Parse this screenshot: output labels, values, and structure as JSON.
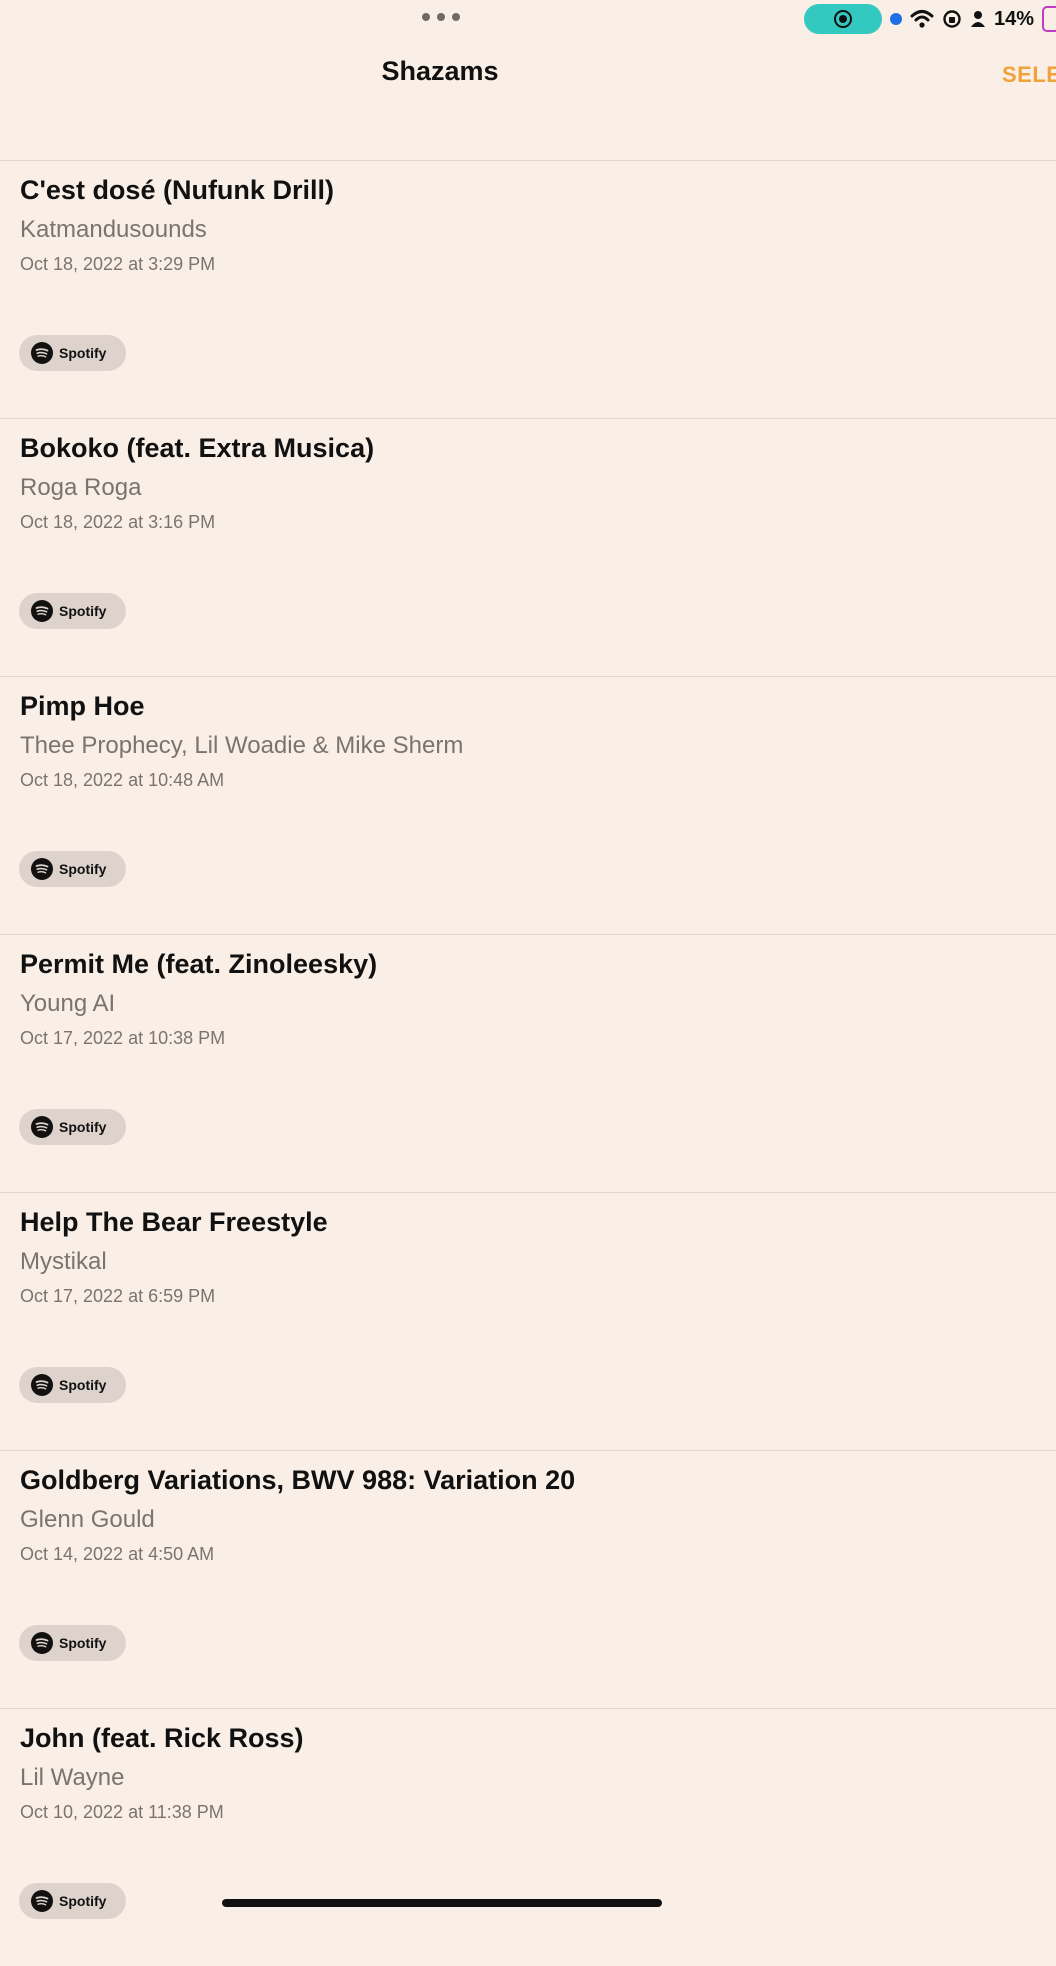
{
  "status_bar": {
    "battery_percent": "14%",
    "icons": [
      "screen-record-icon",
      "location-dot-icon",
      "wifi-icon",
      "orientation-lock-icon",
      "person-icon",
      "battery-icon"
    ]
  },
  "nav": {
    "title": "Shazams",
    "select_label": "SELE"
  },
  "items": [
    {
      "title": "C'est dosé (Nufunk Drill)",
      "artist": "Katmandusounds",
      "date": "Oct 18, 2022 at 3:29 PM",
      "service": "Spotify"
    },
    {
      "title": "Bokoko (feat. Extra Musica)",
      "artist": "Roga Roga",
      "date": "Oct 18, 2022 at 3:16 PM",
      "service": "Spotify"
    },
    {
      "title": "Pimp Hoe",
      "artist": "Thee Prophecy, Lil Woadie & Mike Sherm",
      "date": "Oct 18, 2022 at 10:48 AM",
      "service": "Spotify"
    },
    {
      "title": "Permit Me (feat. Zinoleesky)",
      "artist": "Young AI",
      "date": "Oct 17, 2022 at 10:38 PM",
      "service": "Spotify"
    },
    {
      "title": "Help The Bear Freestyle",
      "artist": "Mystikal",
      "date": "Oct 17, 2022 at 6:59 PM",
      "service": "Spotify"
    },
    {
      "title": "Goldberg Variations, BWV 988: Variation 20",
      "artist": "Glenn Gould",
      "date": "Oct 14, 2022 at 4:50 AM",
      "service": "Spotify"
    },
    {
      "title": "John (feat. Rick Ross)",
      "artist": "Lil Wayne",
      "date": "Oct 10, 2022 at 11:38 PM",
      "service": "Spotify"
    }
  ],
  "colors": {
    "background": "#f9efe6",
    "accent": "#f2a23a",
    "record_pill": "#34c9c0"
  }
}
